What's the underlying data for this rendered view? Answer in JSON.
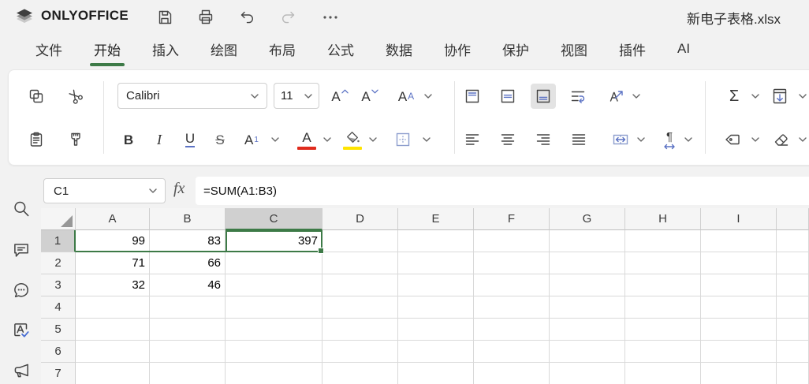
{
  "topbar": {
    "brand": "ONLYOFFICE",
    "filename": "新电子表格.xlsx"
  },
  "tabs": [
    {
      "label": "文件",
      "active": false
    },
    {
      "label": "开始",
      "active": true
    },
    {
      "label": "插入",
      "active": false
    },
    {
      "label": "绘图",
      "active": false
    },
    {
      "label": "布局",
      "active": false
    },
    {
      "label": "公式",
      "active": false
    },
    {
      "label": "数据",
      "active": false
    },
    {
      "label": "协作",
      "active": false
    },
    {
      "label": "保护",
      "active": false
    },
    {
      "label": "视图",
      "active": false
    },
    {
      "label": "插件",
      "active": false
    },
    {
      "label": "AI",
      "active": false
    }
  ],
  "ribbon": {
    "font_name": "Calibri",
    "font_size": "11",
    "bold": "B",
    "italic": "I",
    "underline": "U",
    "strikeout": "S",
    "letter_a": "A",
    "subscript_digit": "1",
    "case_secondary": "A",
    "sigma": "Σ",
    "pilcrow": "¶"
  },
  "formula_bar": {
    "cell_reference": "C1",
    "fx_label": "fx",
    "formula": "=SUM(A1:B3)"
  },
  "sheet": {
    "column_headers": [
      "A",
      "B",
      "C",
      "D",
      "E",
      "F",
      "G",
      "H",
      "I",
      ""
    ],
    "row_headers": [
      "1",
      "2",
      "3",
      "4",
      "5",
      "6",
      "7"
    ],
    "cells": [
      {
        "ref": "A1",
        "value": "99"
      },
      {
        "ref": "B1",
        "value": "83"
      },
      {
        "ref": "C1",
        "value": "397"
      },
      {
        "ref": "A2",
        "value": "71"
      },
      {
        "ref": "B2",
        "value": "66"
      },
      {
        "ref": "A3",
        "value": "32"
      },
      {
        "ref": "B3",
        "value": "46"
      }
    ],
    "selected_cell": "C1",
    "selected_column": "C",
    "selected_row": "1",
    "referenced_bottom_edge_cols": [
      "A",
      "B"
    ]
  },
  "colors": {
    "accent_green": "#3d7a47",
    "font_color_red": "#e02b1d",
    "highlight_yellow": "#ffe400",
    "icon_blue": "#5b72c4",
    "disabled_gray": "#b9b9b9"
  }
}
